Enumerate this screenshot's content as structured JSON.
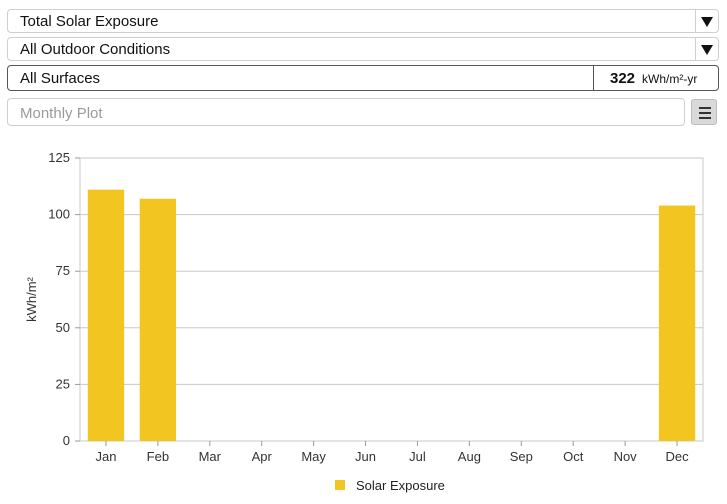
{
  "selectors": {
    "metric": "Total Solar Exposure",
    "conditions": "All Outdoor Conditions"
  },
  "surfaces": {
    "label": "All Surfaces",
    "value": "322",
    "unit": "kWh/m²-yr"
  },
  "plot_type": {
    "placeholder": "Monthly Plot"
  },
  "icons": {
    "menu": "hamburger-menu-icon",
    "dropdown": "triangle-down-icon"
  },
  "chart_data": {
    "type": "bar",
    "categories": [
      "Jan",
      "Feb",
      "Mar",
      "Apr",
      "May",
      "Jun",
      "Jul",
      "Aug",
      "Sep",
      "Oct",
      "Nov",
      "Dec"
    ],
    "series": [
      {
        "name": "Solar Exposure",
        "values": [
          111,
          107,
          0,
          0,
          0,
          0,
          0,
          0,
          0,
          0,
          0,
          104
        ],
        "color": "#f2c521"
      }
    ],
    "ylabel": "kWh/m²",
    "xlabel": "",
    "ylim": [
      0,
      125
    ],
    "yticks": [
      0,
      25,
      50,
      75,
      100,
      125
    ],
    "grid": true,
    "legend": "bottom-center"
  }
}
